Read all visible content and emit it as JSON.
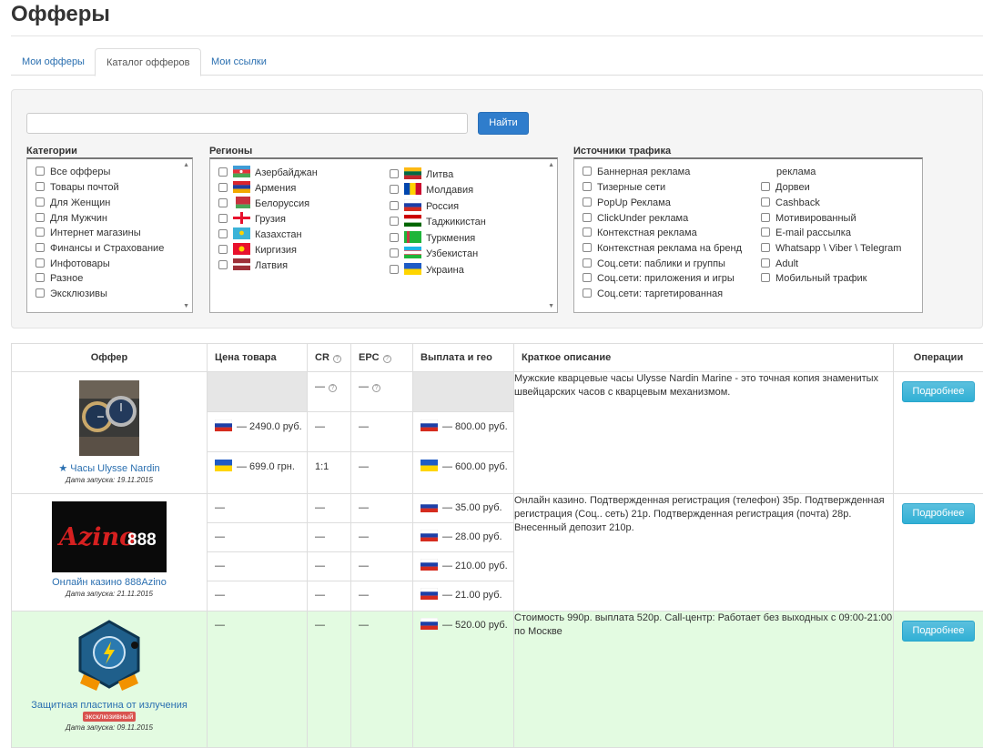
{
  "page": {
    "title": "Офферы"
  },
  "tabs": [
    "Мои офферы",
    "Каталог офферов",
    "Мои ссылки"
  ],
  "search": {
    "value": "",
    "button": "Найти"
  },
  "filters": {
    "categories": {
      "label": "Категории",
      "items": [
        "Все офферы",
        "Товары почтой",
        "Для Женщин",
        "Для Мужчин",
        "Интернет магазины",
        "Финансы и Страхование",
        "Инфотовары",
        "Разное",
        "Эксклюзивы"
      ]
    },
    "regions": {
      "label": "Регионы",
      "col1": [
        "Азербайджан",
        "Армения",
        "Белоруссия",
        "Грузия",
        "Казахстан",
        "Киргизия",
        "Латвия"
      ],
      "col2": [
        "Литва",
        "Молдавия",
        "Россия",
        "Таджикистан",
        "Туркмения",
        "Узбекистан",
        "Украина"
      ]
    },
    "traffic": {
      "label": "Источники трафика",
      "col1": [
        "Баннерная реклама",
        "Тизерные сети",
        "PopUp Реклама",
        "ClickUnder реклама",
        "Контекстная реклама",
        "Контекстная реклама на бренд",
        "Соц.сети: паблики и группы",
        "Соц.сети: приложения и игры",
        "Соц.сети: таргетированная"
      ],
      "col2_top": "реклама",
      "col2": [
        "Дорвеи",
        "Cashback",
        "Мотивированный",
        "E-mail рассылка",
        "Whatsapp \\ Viber \\ Telegram",
        "Adult",
        "Мобильный трафик"
      ]
    }
  },
  "table": {
    "headers": {
      "offer": "Оффер",
      "price": "Цена товара",
      "cr": "CR",
      "epc": "EPC",
      "payout": "Выплата и гео",
      "description": "Краткое описание",
      "operations": "Операции"
    },
    "help_glyph": "?",
    "button_label": "Подробнее",
    "offers": [
      {
        "name": "★ Часы Ulysse Nardin",
        "launch": "Дата запуска: 19.11.2015",
        "image": "watch",
        "summary_cr": "—",
        "summary_epc": "—",
        "rows": [
          {
            "price": "— 2490.0 руб.",
            "cr": "—",
            "epc": "—",
            "payout": "— 800.00 руб."
          },
          {
            "price": "— 699.0 грн.",
            "cr": "1:1",
            "epc": "—",
            "payout": "— 600.00 руб."
          }
        ],
        "description": "Мужские кварцевые часы Ulysse Nardin Marine - это точная копия знаменитых швейцарских часов с кварцевым механизмом."
      },
      {
        "name": "Онлайн казино 888Azino",
        "launch": "Дата запуска: 21.11.2015",
        "image": "azino",
        "logo_text": "Azino",
        "logo_num": "888",
        "rows": [
          {
            "price": "—",
            "cr": "—",
            "epc": "—",
            "payout": "— 35.00 руб."
          },
          {
            "price": "—",
            "cr": "—",
            "epc": "—",
            "payout": "— 28.00 руб."
          },
          {
            "price": "—",
            "cr": "—",
            "epc": "—",
            "payout": "— 210.00 руб."
          },
          {
            "price": "—",
            "cr": "—",
            "epc": "—",
            "payout": "— 21.00 руб."
          }
        ],
        "description": "Онлайн казино. Подтвержденная регистрация (телефон) 35р. Подтвержденная регистрация (Соц.. сеть) 21р. Подтвержденная регистрация (почта) 28р. Внесенный депозит 210р."
      },
      {
        "name": "Защитная пластина от излучения",
        "badge": "эксклюзивный",
        "launch": "Дата запуска: 09.11.2015",
        "image": "shield",
        "rows": [
          {
            "price": "—",
            "cr": "—",
            "epc": "—",
            "payout": "— 520.00 руб."
          }
        ],
        "description": "Стоимость 990р. выплата 520р. Call-центр: Работает без выходных с 09:00-21:00 по Москве"
      }
    ]
  },
  "colors": {
    "highlight": "#e3fbe1",
    "accent": "#2f7dcc",
    "info_button": "#5bc0de"
  }
}
